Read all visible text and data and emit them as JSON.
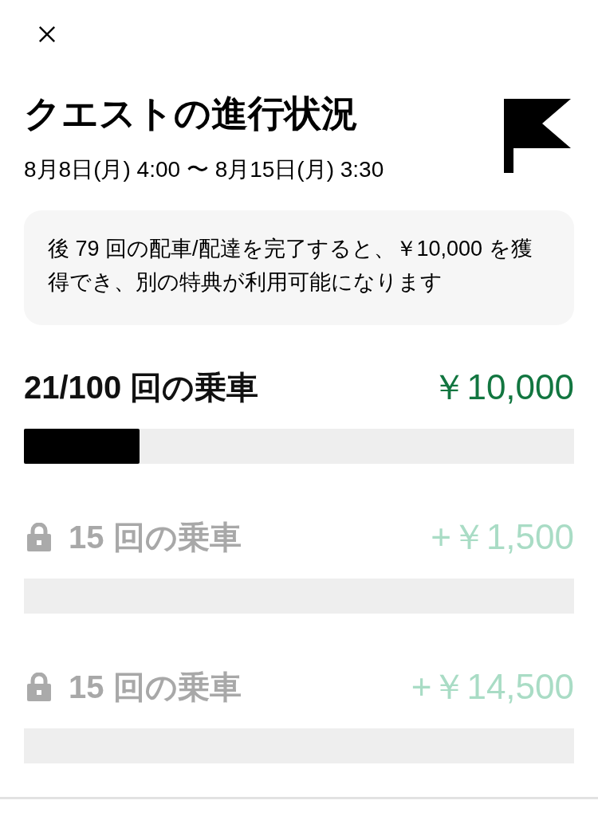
{
  "header": {
    "title": "クエストの進行状況",
    "date_range": "8月8日(月) 4:00 〜 8月15日(月) 3:30"
  },
  "info": {
    "text": "後 79 回の配車/配達を完了すると、￥10,000 を獲得でき、別の特典が利用可能になります"
  },
  "tiers": [
    {
      "label": "21/100 回の乗車",
      "reward": "￥10,000",
      "locked": false,
      "level": 0.21
    },
    {
      "label": "15 回の乗車",
      "reward": "+￥1,500",
      "locked": true
    },
    {
      "label": "15 回の乗車",
      "reward": "+￥14,500",
      "locked": true
    }
  ]
}
